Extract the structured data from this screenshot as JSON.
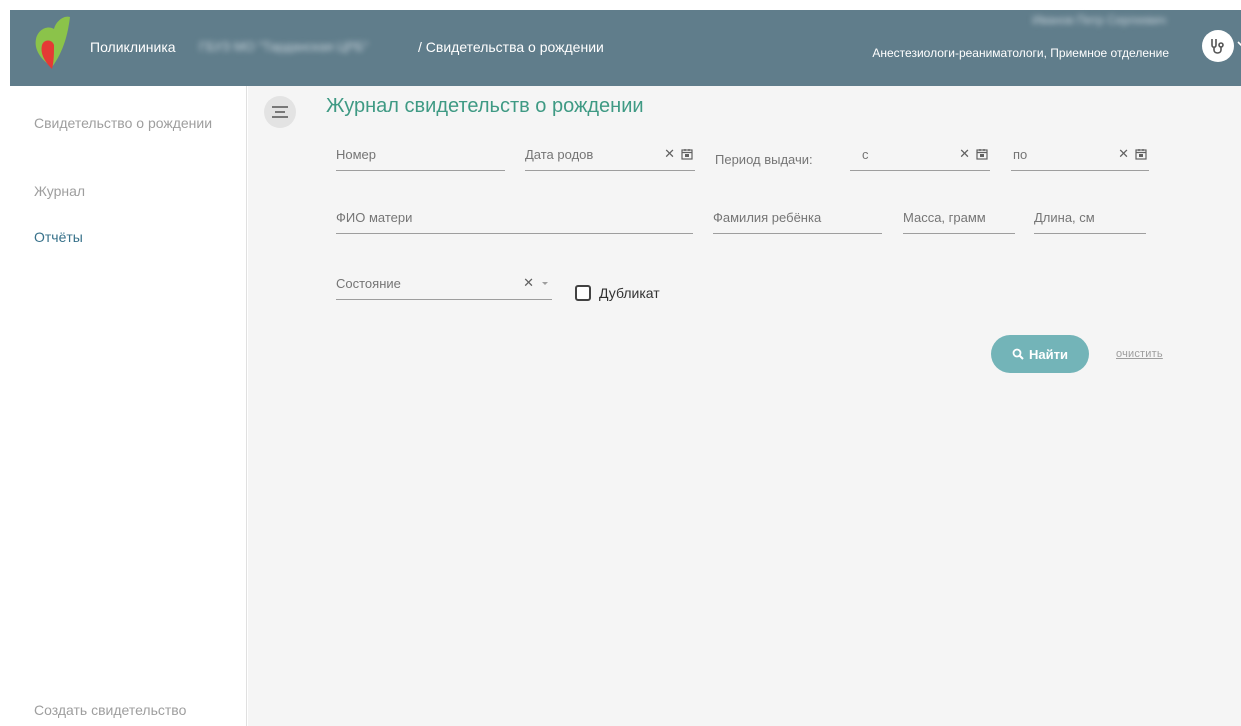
{
  "header": {
    "app_name": "Поликлиника",
    "org_name": "ГБУЗ МО \"Тарданская ЦРБ\"",
    "section": "/ Свидетельства о рождении",
    "user_name": "Иванов Петр Сергеевич",
    "user_role": "Анестезиологи-реаниматологи, Приемное отделение",
    "colors": {
      "bar": "#607d8b",
      "logo_green": "#8bc34a",
      "logo_red": "#e53935"
    }
  },
  "sidebar": {
    "items": [
      {
        "label": "Свидетельство о рождении",
        "active": false
      },
      {
        "label": "Журнал",
        "active": false
      },
      {
        "label": "Отчёты",
        "active": true
      }
    ],
    "create_label": "Создать свидетельство"
  },
  "main": {
    "title": "Журнал свидетельств о рождении",
    "filters": {
      "number_placeholder": "Номер",
      "birth_date_placeholder": "Дата родов",
      "period_label": "Период выдачи:",
      "period_from_placeholder": "с",
      "period_to_placeholder": "по",
      "mother_name_placeholder": "ФИО матери",
      "child_surname_placeholder": "Фамилия ребёнка",
      "mass_placeholder": "Масса, грамм",
      "length_placeholder": "Длина, см",
      "state_placeholder": "Состояние",
      "duplicate_label": "Дубликат",
      "duplicate_checked": false
    },
    "find_label": "Найти",
    "clear_label": "очистить",
    "accent_color": "#3f9a84",
    "button_color": "#73b4b8"
  }
}
